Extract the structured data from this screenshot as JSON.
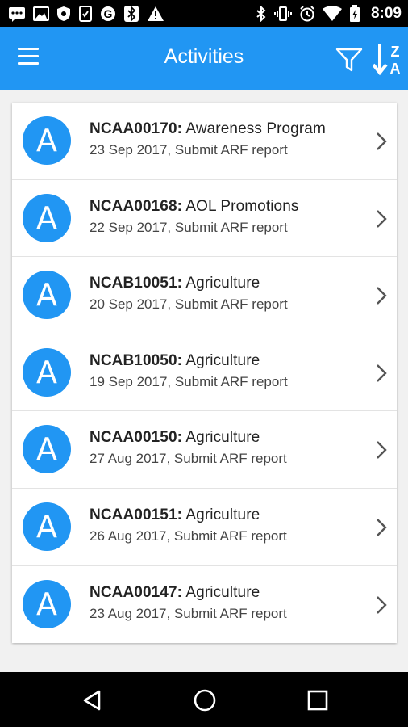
{
  "status_bar": {
    "time": "8:09",
    "left_icons": [
      "message-icon",
      "image-icon",
      "shield-icon",
      "file-icon",
      "g-icon",
      "bluetooth-icon",
      "warning-icon"
    ],
    "right_icons": [
      "bluetooth-icon",
      "vibrate-icon",
      "alarm-icon",
      "wifi-icon",
      "battery-icon"
    ]
  },
  "app_bar": {
    "title": "Activities",
    "menu_icon": "menu-icon",
    "filter_icon": "filter-icon",
    "sort_icon": "sort-z-a-icon",
    "sort_letters": [
      "Z",
      "A"
    ],
    "color": "#2196f3"
  },
  "activities": [
    {
      "avatar": "A",
      "code": "NCAA00170:",
      "name": "Awareness Program",
      "subtitle": "23 Sep 2017, Submit ARF report"
    },
    {
      "avatar": "A",
      "code": "NCAA00168:",
      "name": "AOL Promotions",
      "subtitle": "22 Sep 2017, Submit ARF report"
    },
    {
      "avatar": "A",
      "code": "NCAB10051:",
      "name": "Agriculture",
      "subtitle": "20 Sep 2017, Submit ARF report"
    },
    {
      "avatar": "A",
      "code": "NCAB10050:",
      "name": "Agriculture",
      "subtitle": "19 Sep 2017, Submit ARF report"
    },
    {
      "avatar": "A",
      "code": "NCAA00150:",
      "name": "Agriculture",
      "subtitle": "27 Aug 2017, Submit ARF report"
    },
    {
      "avatar": "A",
      "code": "NCAA00151:",
      "name": "Agriculture",
      "subtitle": "26 Aug 2017, Submit ARF report"
    },
    {
      "avatar": "A",
      "code": "NCAA00147:",
      "name": "Agriculture",
      "subtitle": "23 Aug 2017, Submit ARF report"
    }
  ],
  "nav_bar": {
    "icons": [
      "back-icon",
      "home-icon",
      "recents-icon"
    ]
  }
}
